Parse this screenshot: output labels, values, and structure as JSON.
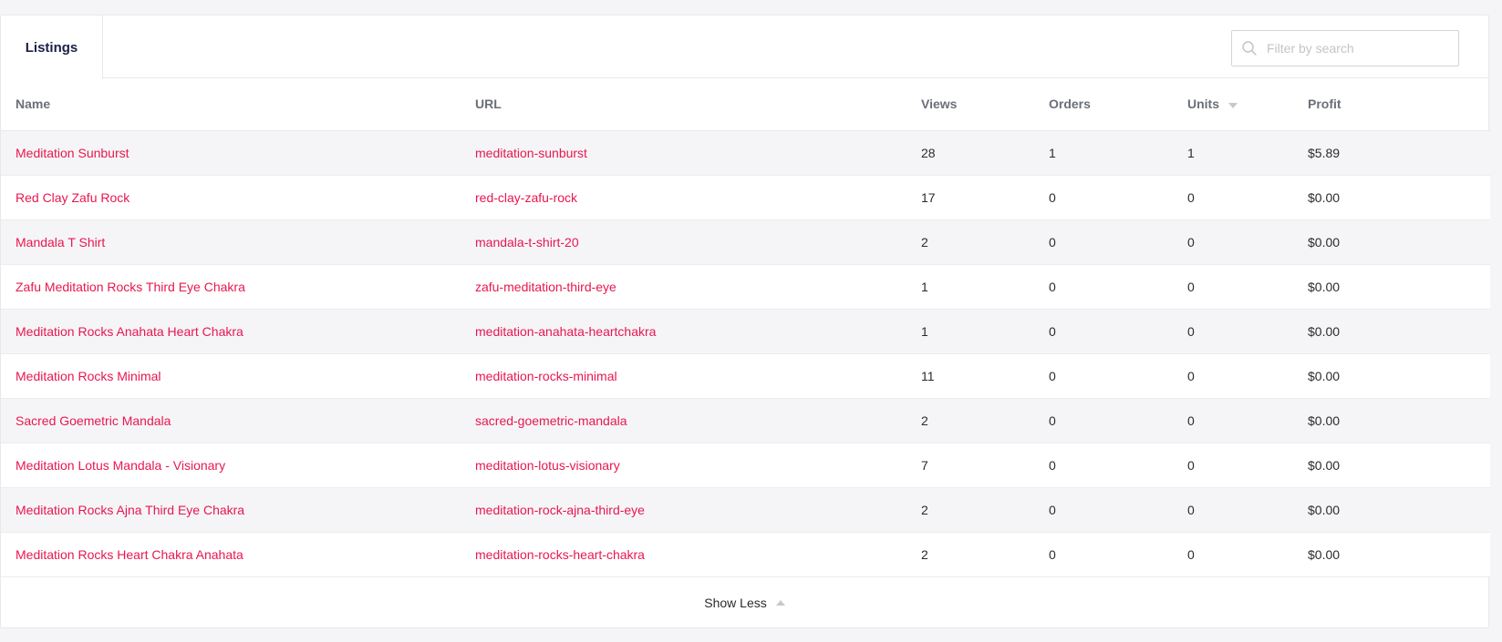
{
  "tabs": [
    {
      "label": "Listings"
    }
  ],
  "search": {
    "placeholder": "Filter by search",
    "value": ""
  },
  "table": {
    "columns": [
      "Name",
      "URL",
      "Views",
      "Orders",
      "Units",
      "Profit"
    ],
    "sorted_column": "Units",
    "rows": [
      {
        "name": "Meditation Sunburst",
        "url": "meditation-sunburst",
        "views": "28",
        "orders": "1",
        "units": "1",
        "profit": "$5.89"
      },
      {
        "name": "Red Clay Zafu Rock",
        "url": "red-clay-zafu-rock",
        "views": "17",
        "orders": "0",
        "units": "0",
        "profit": "$0.00"
      },
      {
        "name": "Mandala T Shirt",
        "url": "mandala-t-shirt-20",
        "views": "2",
        "orders": "0",
        "units": "0",
        "profit": "$0.00"
      },
      {
        "name": "Zafu Meditation Rocks Third Eye Chakra",
        "url": "zafu-meditation-third-eye",
        "views": "1",
        "orders": "0",
        "units": "0",
        "profit": "$0.00"
      },
      {
        "name": "Meditation Rocks Anahata Heart Chakra",
        "url": "meditation-anahata-heartchakra",
        "views": "1",
        "orders": "0",
        "units": "0",
        "profit": "$0.00"
      },
      {
        "name": "Meditation Rocks Minimal",
        "url": "meditation-rocks-minimal",
        "views": "11",
        "orders": "0",
        "units": "0",
        "profit": "$0.00"
      },
      {
        "name": "Sacred Goemetric Mandala",
        "url": "sacred-goemetric-mandala",
        "views": "2",
        "orders": "0",
        "units": "0",
        "profit": "$0.00"
      },
      {
        "name": "Meditation Lotus Mandala - Visionary",
        "url": "meditation-lotus-visionary",
        "views": "7",
        "orders": "0",
        "units": "0",
        "profit": "$0.00"
      },
      {
        "name": "Meditation Rocks Ajna Third Eye Chakra",
        "url": "meditation-rock-ajna-third-eye",
        "views": "2",
        "orders": "0",
        "units": "0",
        "profit": "$0.00"
      },
      {
        "name": "Meditation Rocks Heart Chakra Anahata",
        "url": "meditation-rocks-heart-chakra",
        "views": "2",
        "orders": "0",
        "units": "0",
        "profit": "$0.00"
      }
    ]
  },
  "footer": {
    "toggle_label": "Show Less"
  },
  "colors": {
    "link": "#e8174f",
    "tab_text": "#1c1f4a",
    "header_text": "#6b6f78",
    "row_alt": "#f5f5f7"
  },
  "icons": {
    "search": "search-icon",
    "sort": "chevron-down-icon",
    "collapse": "chevron-up-icon"
  }
}
